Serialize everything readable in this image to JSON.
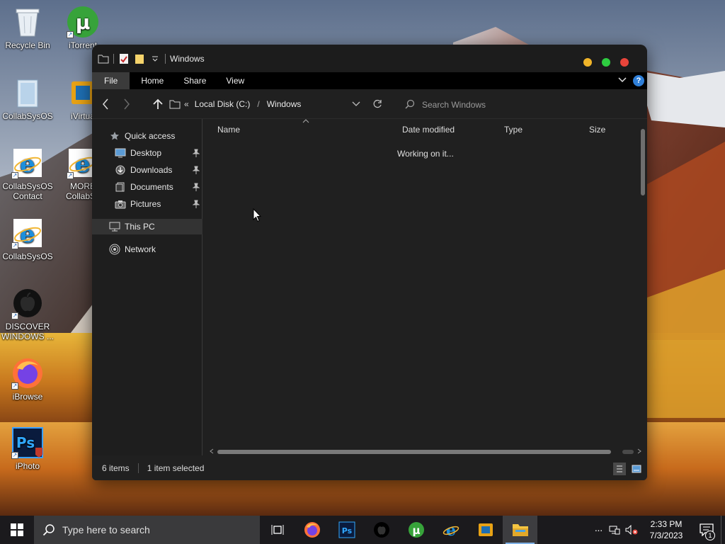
{
  "desktop": {
    "icons": [
      {
        "label": "Recycle Bin",
        "icon": "recycle-bin-icon"
      },
      {
        "label": "iTorrent",
        "icon": "utorrent-icon"
      },
      {
        "label": "CollabSysOS",
        "icon": "folder-icon"
      },
      {
        "label": "iVirtua",
        "icon": "virtualbox-icon"
      },
      {
        "label": "CollabSysOS Contact",
        "icon": "internet-explorer-icon"
      },
      {
        "label": "MORE CollabSy",
        "icon": "internet-explorer-icon"
      },
      {
        "label": "CollabSysOS",
        "icon": "internet-explorer-icon"
      },
      {
        "label": "DISCOVER WINDOWS ...",
        "icon": "apple-icon"
      },
      {
        "label": "iBrowse",
        "icon": "firefox-icon"
      },
      {
        "label": "iPhoto",
        "icon": "photoshop-icon"
      }
    ]
  },
  "window": {
    "title": "Windows",
    "ribbon_tabs": [
      "File",
      "Home",
      "Share",
      "View"
    ],
    "help_label": "?",
    "breadcrumb": {
      "overflow": "«",
      "items": [
        "Local Disk (C:)",
        "Windows"
      ],
      "separator": "/"
    },
    "search": {
      "placeholder": "Search Windows"
    },
    "nav_pane": {
      "quick_access": "Quick access",
      "pinned": [
        "Desktop",
        "Downloads",
        "Documents",
        "Pictures"
      ],
      "this_pc": "This PC",
      "network": "Network"
    },
    "columns": [
      "Name",
      "Date modified",
      "Type",
      "Size"
    ],
    "status_message": "Working on it...",
    "statusbar": {
      "items": "6 items",
      "selected": "1 item selected"
    }
  },
  "taskbar": {
    "search_placeholder": "Type here to search",
    "apps": [
      "task-view-icon",
      "firefox-icon",
      "photoshop-icon",
      "apple-icon",
      "utorrent-icon",
      "internet-explorer-icon",
      "virtualbox-icon",
      "file-explorer-icon"
    ],
    "overflow_label": "···",
    "time": "2:33 PM",
    "date": "7/3/2023",
    "notification_count": "1"
  },
  "colors": {
    "window_bg": "#202020",
    "ribbon_bg": "#000000",
    "traffic_yellow": "#f0b429",
    "traffic_green": "#2ecc40",
    "traffic_red": "#e8443a",
    "accent_blue": "#2f7fd8"
  }
}
